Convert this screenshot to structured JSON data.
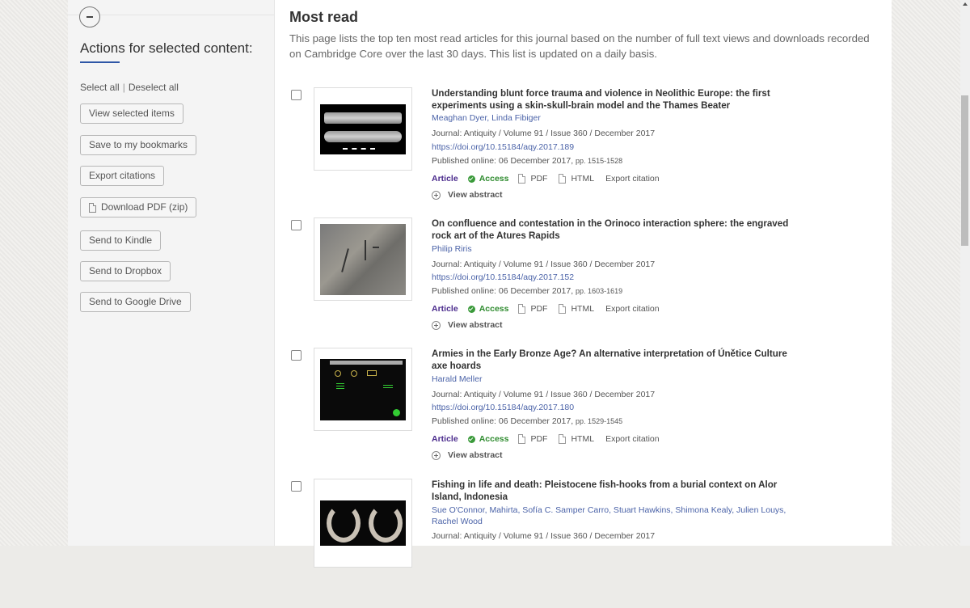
{
  "sidebar": {
    "collapse_icon": "minus-circle-icon",
    "title": "Actions for selected content:",
    "select_all": "Select all",
    "separator": "|",
    "deselect_all": "Deselect all",
    "buttons": [
      {
        "label": "View selected items"
      },
      {
        "label": "Save to my bookmarks"
      },
      {
        "label": "Export citations"
      },
      {
        "label": "Download PDF (zip)",
        "icon": "pdf-icon"
      },
      {
        "label": "Send to Kindle"
      },
      {
        "label": "Send to Dropbox"
      },
      {
        "label": "Send to Google Drive"
      }
    ]
  },
  "main": {
    "title": "Most read",
    "intro": "This page lists the top ten most read articles for this journal based on the number of full text views and downloads recorded on Cambridge Core over the last 30 days. This list is updated on a daily basis.",
    "link_labels": {
      "type": "Article",
      "access": "Access",
      "pdf": "PDF",
      "html": "HTML",
      "export": "Export citation",
      "abstract": "View abstract"
    },
    "articles": [
      {
        "title": "Understanding blunt force trauma and violence in Neolithic Europe: the first experiments using a skin-skull-brain model and the Thames Beater",
        "authors": "Meaghan Dyer, Linda Fibiger",
        "journal": "Journal: Antiquity / Volume 91 / Issue 360 / December 2017",
        "doi": "https://doi.org/10.15184/aqy.2017.189",
        "published": "Published online: 06 December 2017,",
        "pages": "pp. 1515-1528"
      },
      {
        "title": "On confluence and contestation in the Orinoco interaction sphere: the engraved rock art of the Atures Rapids",
        "authors": "Philip Riris",
        "journal": "Journal: Antiquity / Volume 91 / Issue 360 / December 2017",
        "doi": "https://doi.org/10.15184/aqy.2017.152",
        "published": "Published online: 06 December 2017,",
        "pages": "pp. 1603-1619"
      },
      {
        "title": "Armies in the Early Bronze Age? An alternative interpretation of Únětice Culture axe hoards",
        "authors": "Harald Meller",
        "journal": "Journal: Antiquity / Volume 91 / Issue 360 / December 2017",
        "doi": "https://doi.org/10.15184/aqy.2017.180",
        "published": "Published online: 06 December 2017,",
        "pages": "pp. 1529-1545"
      },
      {
        "title": "Fishing in life and death: Pleistocene fish-hooks from a burial context on Alor Island, Indonesia",
        "authors": "Sue O'Connor, Mahirta, Sofía C. Samper Carro, Stuart Hawkins, Shimona Kealy, Julien Louys, Rachel Wood",
        "journal": "Journal: Antiquity / Volume 91 / Issue 360 / December 2017"
      }
    ]
  },
  "colors": {
    "link": "#4b63a8",
    "article_type": "#4a2a8c",
    "access": "#2e8b2e",
    "accent_underline": "#2e56a6"
  }
}
